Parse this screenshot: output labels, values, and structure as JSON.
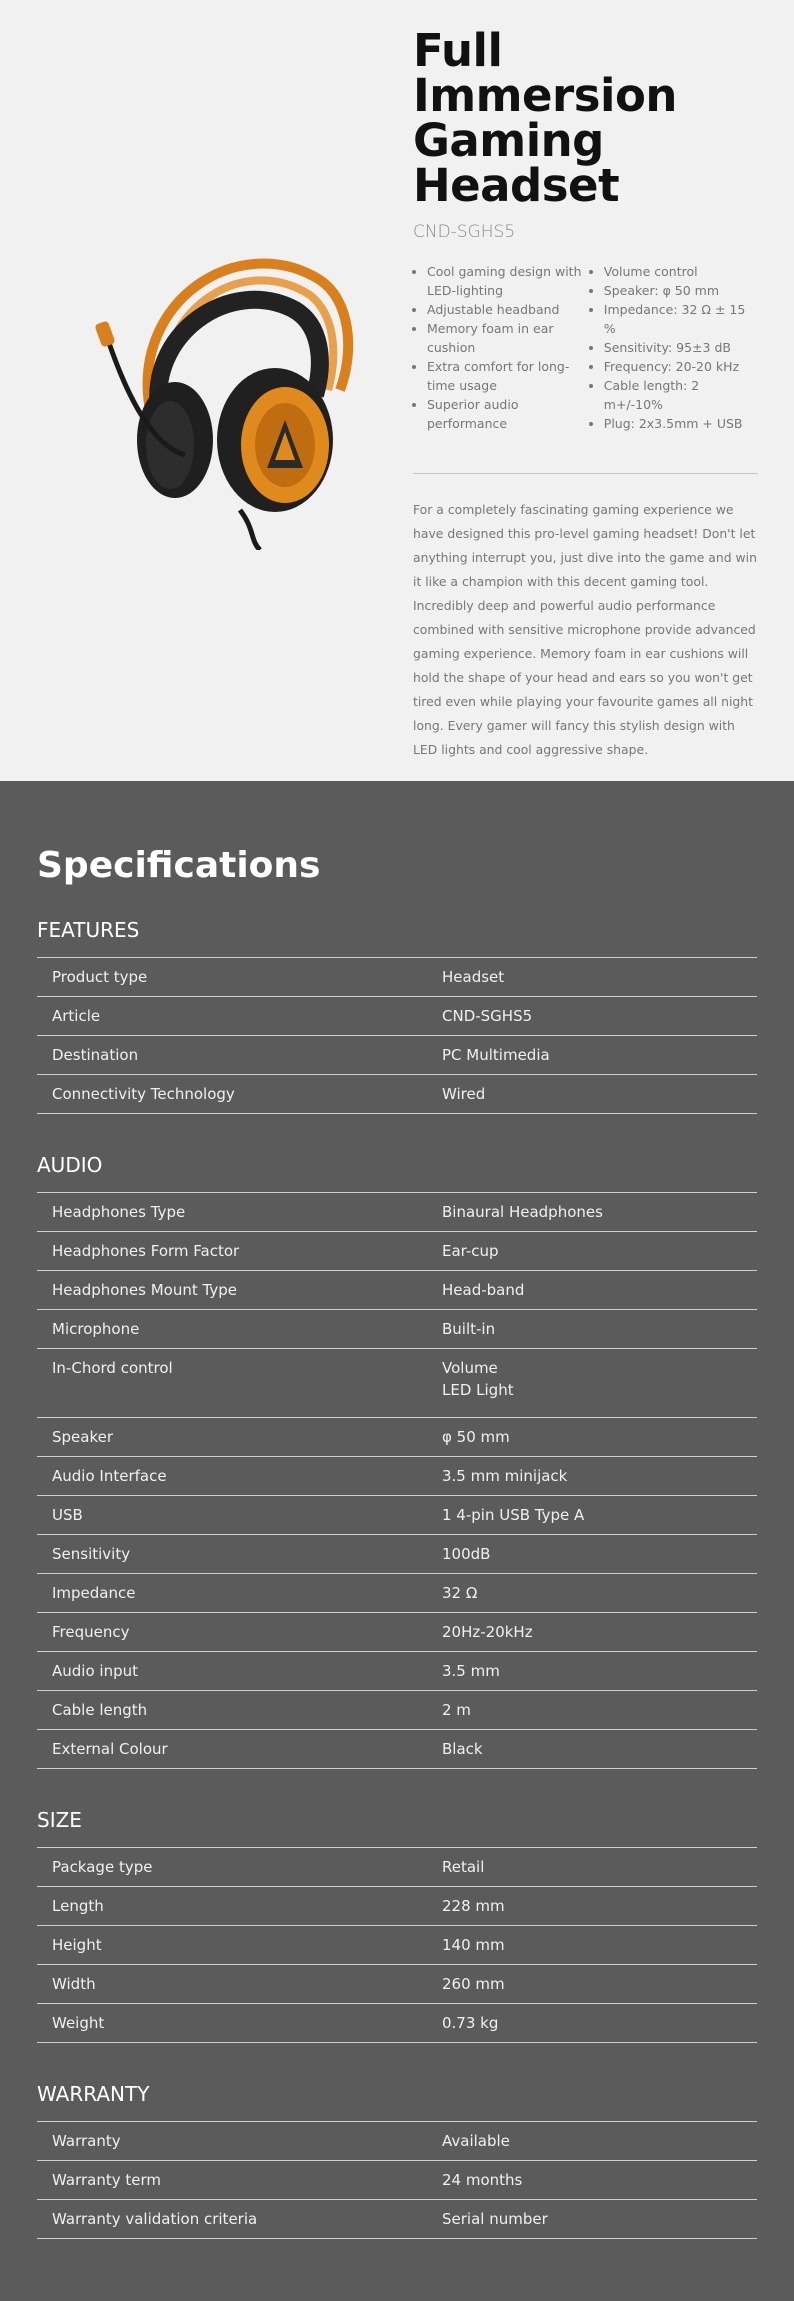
{
  "hero": {
    "title_lines": [
      "Full",
      "Immersion",
      "Gaming",
      "Headset"
    ],
    "model": "CND-SGHS5",
    "features_left": [
      "Cool gaming design with LED-lighting",
      "Adjustable headband",
      "Memory foam in ear cushion",
      "Extra comfort for long-time usage",
      "Superior audio performance"
    ],
    "features_right": [
      "Volume control",
      "Speaker: φ 50 mm",
      "Impedance: 32 Ω ± 15 %",
      "Sensitivity: 95±3 dB",
      "Frequency: 20-20 kHz",
      "Cable length: 2 m+/-10%",
      "Plug: 2x3.5mm + USB"
    ],
    "description": "For a completely fascinating gaming experience we have designed this pro-level gaming headset! Don't let anything interrupt you, just dive into the game and win it like a champion with this decent gaming tool. Incredibly deep and powerful audio performance combined with sensitive microphone provide advanced gaming experience. Memory foam in ear cushions will hold the shape of your head and ears so you won't get tired even while playing your favourite games all night long. Every gamer will fancy this stylish design with LED lights and cool aggressive shape.",
    "colors": {
      "accent_orange": "#e08a1e",
      "dark": "#1e1e1e"
    },
    "image_icon": "headset-image"
  },
  "specs": {
    "title": "Specifications",
    "sections": {
      "features": {
        "heading": "FEATURES",
        "rows": [
          {
            "k": "Product type",
            "v": "Headset"
          },
          {
            "k": "Article",
            "v": "CND-SGHS5"
          },
          {
            "k": "Destination",
            "v": "PC Multimedia"
          },
          {
            "k": "Connectivity Technology",
            "v": "Wired"
          }
        ]
      },
      "audio": {
        "heading": "AUDIO",
        "rows": [
          {
            "k": "Headphones Type",
            "v": "Binaural Headphones"
          },
          {
            "k": "Headphones Form Factor",
            "v": "Ear-cup"
          },
          {
            "k": "Headphones Mount Type",
            "v": "Head-band"
          },
          {
            "k": "Microphone",
            "v": "Built-in"
          },
          {
            "k": "In-Chord control",
            "v": "Volume",
            "v2": "LED Light"
          },
          {
            "k": "Speaker",
            "v": "φ 50 mm"
          },
          {
            "k": "Audio Interface",
            "v": "3.5 mm minijack"
          },
          {
            "k": "USB",
            "v": "1 4-pin USB Type A"
          },
          {
            "k": "Sensitivity",
            "v": "100dB"
          },
          {
            "k": "Impedance",
            "v": "32 Ω"
          },
          {
            "k": "Frequency",
            "v": "20Hz-20kHz"
          },
          {
            "k": "Audio input",
            "v": "3.5 mm"
          },
          {
            "k": "Cable length",
            "v": "2 m"
          },
          {
            "k": "External Colour",
            "v": "Black"
          }
        ]
      },
      "size": {
        "heading": "SIZE",
        "rows": [
          {
            "k": "Package type",
            "v": "Retail"
          },
          {
            "k": "Length",
            "v": "228 mm"
          },
          {
            "k": "Height",
            "v": "140 mm"
          },
          {
            "k": "Width",
            "v": "260 mm"
          },
          {
            "k": "Weight",
            "v": "0.73 kg"
          }
        ]
      },
      "warranty": {
        "heading": "WARRANTY",
        "rows": [
          {
            "k": "Warranty",
            "v": "Available"
          },
          {
            "k": "Warranty term",
            "v": "24 months"
          },
          {
            "k": "Warranty validation criteria",
            "v": "Serial number"
          }
        ]
      }
    }
  }
}
